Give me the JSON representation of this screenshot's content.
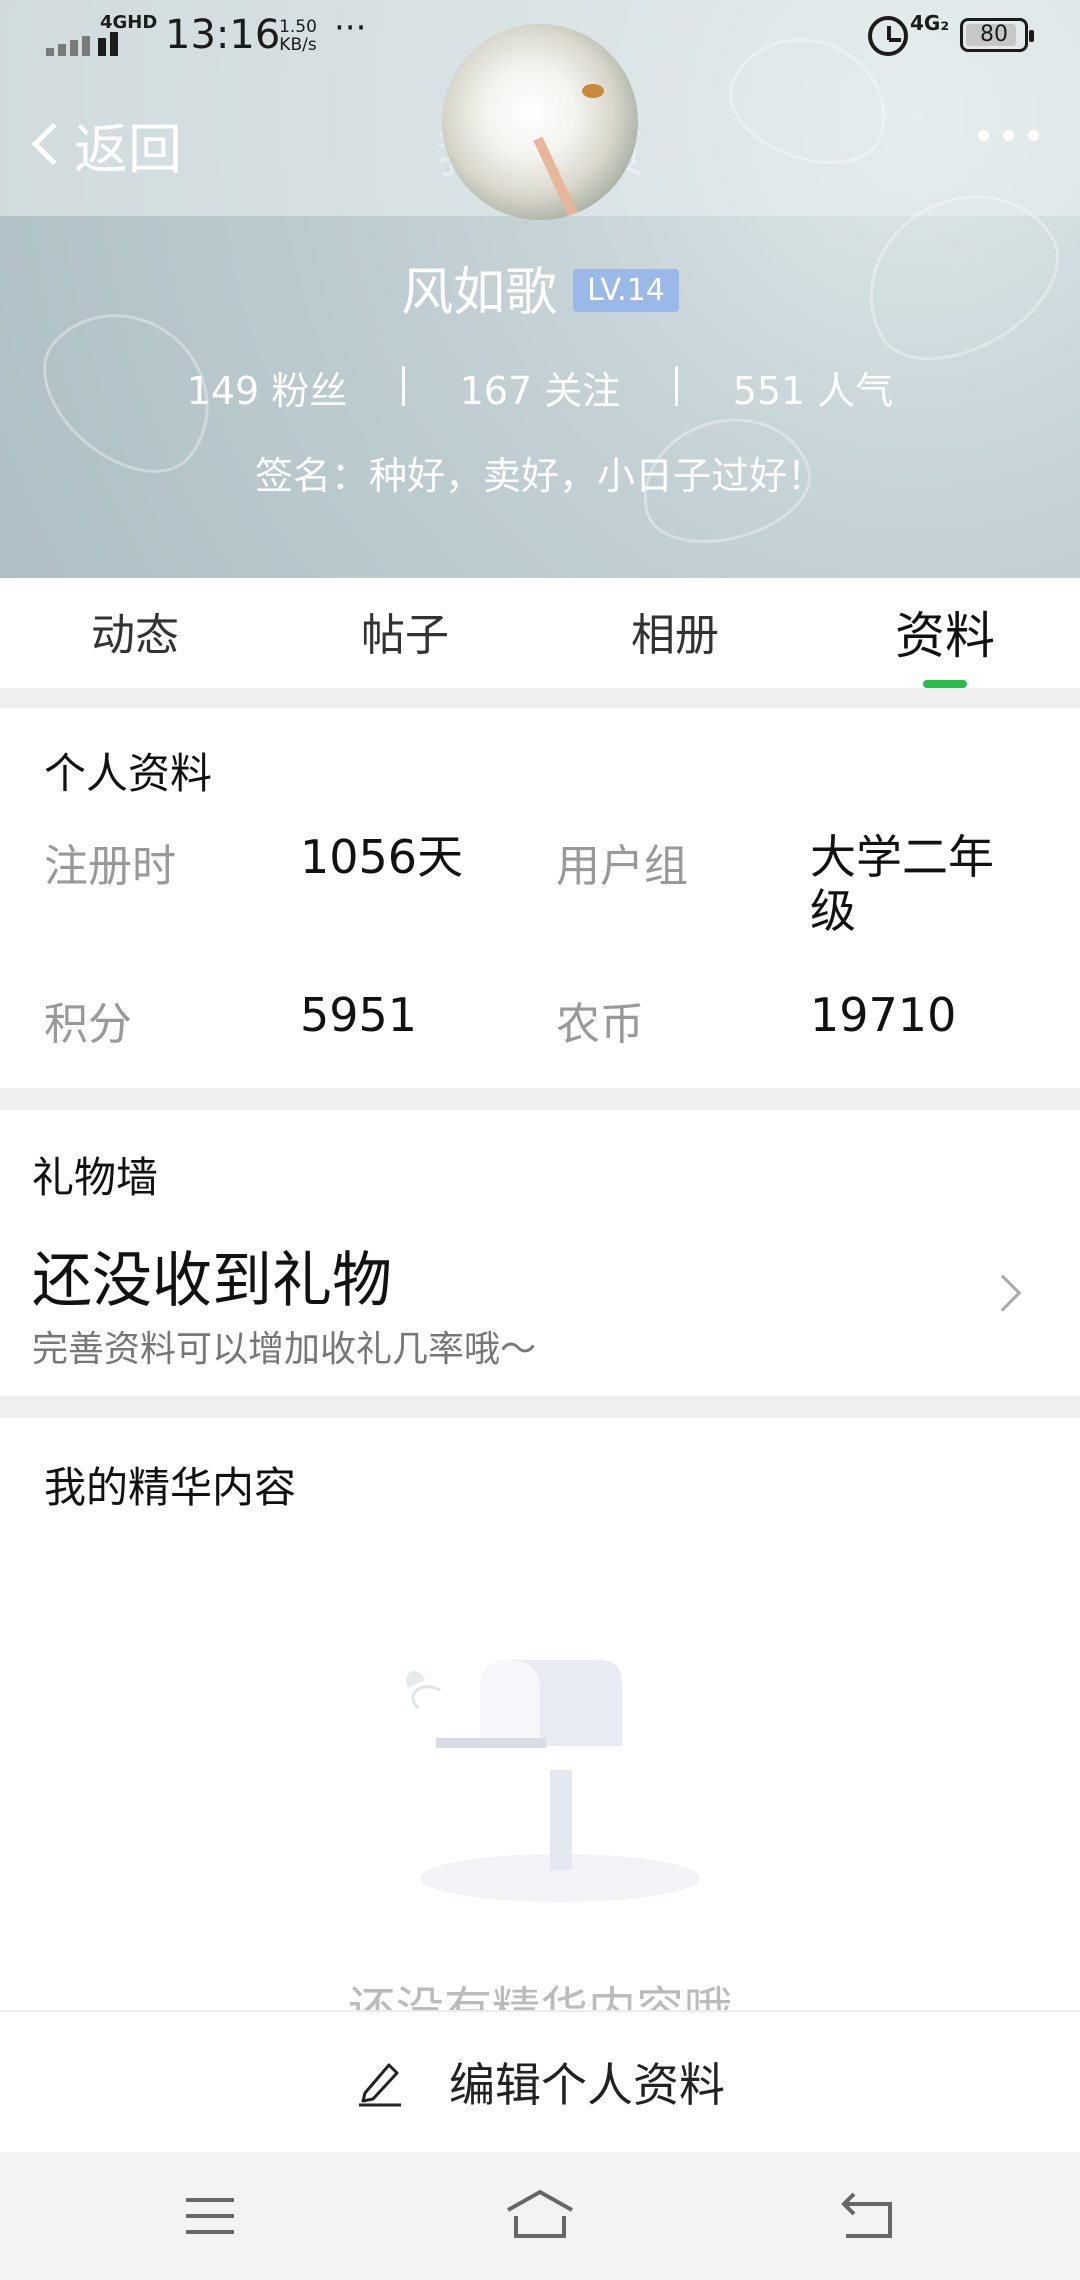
{
  "status_bar": {
    "network": "4GHD",
    "time": "13:16",
    "speed_value": "1.50",
    "speed_unit": "KB/s",
    "dots": "···",
    "network_right": "4G₂",
    "battery": "80"
  },
  "header": {
    "back_label": "返回",
    "title_faded": "我的主页"
  },
  "profile": {
    "name": "风如歌",
    "level": "LV.14",
    "fans": "149 粉丝",
    "following": "167 关注",
    "popularity": "551 人气",
    "signature": "签名：种好，卖好，小日子过好！"
  },
  "tabs": [
    {
      "label": "动态",
      "active": false
    },
    {
      "label": "帖子",
      "active": false
    },
    {
      "label": "相册",
      "active": false
    },
    {
      "label": "资料",
      "active": true
    }
  ],
  "personal_info": {
    "title": "个人资料",
    "registered_label": "注册时",
    "registered_value": "1056天",
    "group_label": "用户组",
    "group_value": "大学二年级",
    "points_label": "积分",
    "points_value": "5951",
    "coins_label": "农币",
    "coins_value": "19710"
  },
  "gift_wall": {
    "title": "礼物墙",
    "main": "还没收到礼物",
    "sub": "完善资料可以增加收礼几率哦～"
  },
  "featured": {
    "title": "我的精华内容",
    "empty_text": "还没有精华内容哦"
  },
  "edit_bar": {
    "label": "编辑个人资料"
  },
  "colors": {
    "accent_green": "#2bbb4a",
    "level_badge": "#9ab8e8",
    "banner": "#b8c8cd"
  }
}
